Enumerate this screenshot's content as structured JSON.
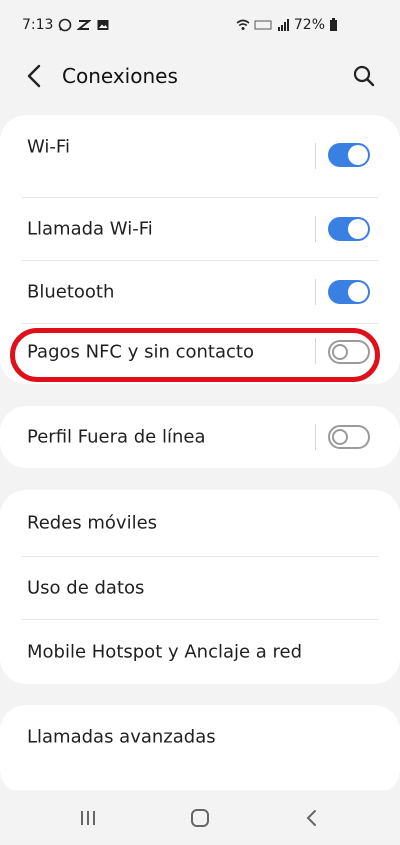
{
  "status_bar": {
    "time": "7:13",
    "battery": "72%"
  },
  "header": {
    "title": "Conexiones"
  },
  "group1": {
    "items": [
      {
        "label": "Wi-Fi",
        "toggle": "on"
      },
      {
        "label": "Llamada Wi-Fi",
        "toggle": "on"
      },
      {
        "label": "Bluetooth",
        "toggle": "on"
      },
      {
        "label": "Pagos NFC y sin contacto",
        "toggle": "off"
      }
    ]
  },
  "group2": {
    "items": [
      {
        "label": "Perfil Fuera de línea",
        "toggle": "off"
      }
    ]
  },
  "group3": {
    "items": [
      {
        "label": "Redes móviles"
      },
      {
        "label": "Uso de datos"
      },
      {
        "label": "Mobile Hotspot y Anclaje a red"
      }
    ]
  },
  "group4": {
    "items": [
      {
        "label": "Llamadas avanzadas"
      }
    ]
  },
  "colors": {
    "toggle_on": "#3a7fe2",
    "highlight": "#e0101a"
  }
}
